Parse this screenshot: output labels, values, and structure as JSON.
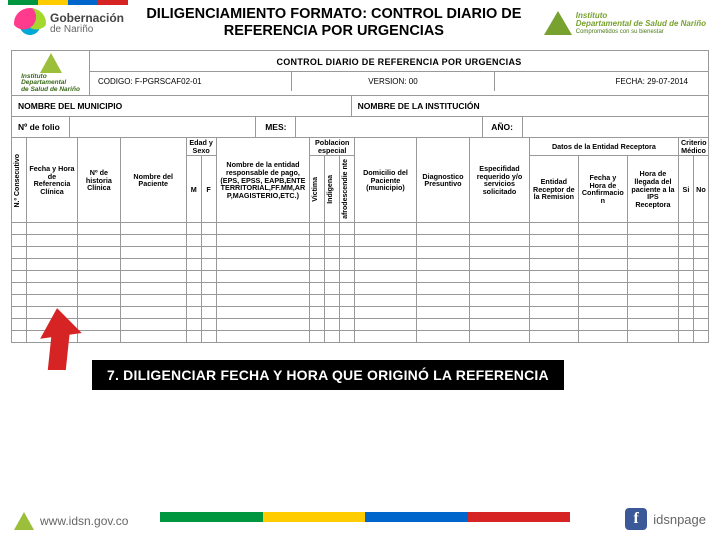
{
  "colors": {
    "green": "#009640",
    "yellow": "#ffcc00",
    "blue": "#0066cc",
    "red": "#d62424"
  },
  "header": {
    "gob_label": "Gobernación",
    "gob_sub": "de Nariño",
    "title": "DILIGENCIAMIENTO FORMATO: CONTROL DIARIO DE REFERENCIA POR URGENCIAS",
    "idsn_line1": "Instituto",
    "idsn_line2": "Departamental de Salud de Nariño",
    "idsn_tag": "Comprometidos con su bienestar"
  },
  "sheet": {
    "logo_line1": "Instituto",
    "logo_line2": "Departamental",
    "logo_line3": "de Salud de Nariño",
    "heading": "CONTROL DIARIO DE REFERENCIA POR URGENCIAS",
    "codigo_lab": "CODIGO:",
    "codigo_val": "F-PGRSCAF02-01",
    "version_lab": "VERSION:",
    "version_val": "00",
    "fecha_lab": "FECHA:",
    "fecha_val": "29-07-2014",
    "municipio": "NOMBRE DEL MUNICIPIO",
    "institucion": "NOMBRE DE LA INSTITUCIÓN",
    "folio": "Nº de folio",
    "mes": "MES:",
    "ano": "AÑO:"
  },
  "cols": {
    "c0": "N.º Consecutivo",
    "c1": "Fecha y Hora de Referencia Clínica",
    "c2": "Nº de historia Clínica",
    "c3": "Nombre del Paciente",
    "c4": "Edad y Sexo",
    "c4m": "M",
    "c4f": "F",
    "c5": "Nombre de la entidad responsable de pago, (EPS, EPSS, EAPB,ENTE TERRITORIAL,FF.MM,AR P,MAGISTERIO,ETC.)",
    "c6": "Poblacion especial",
    "c6a": "Victima",
    "c6b": "Indigena",
    "c6c": "afrodescendie nte",
    "c7": "Domicilio del Paciente (municipio)",
    "c8": "Diagnostico Presuntivo",
    "c9": "Especifidad requerido y/o servicios solicitado",
    "c10": "Datos de la Entidad Receptora",
    "c10a": "Entidad Receptor de la Remision",
    "c10b": "Fecha y Hora de Confirmacio n",
    "c10c": "Hora de llegada del paciente a la IPS Receptora",
    "c11": "Criterio Médico",
    "c11a": "Si",
    "c11b": "No"
  },
  "caption": "7. DILIGENCIAR FECHA Y HORA QUE ORIGINÓ LA REFERENCIA",
  "footer": {
    "url": "www.idsn.gov.co",
    "page": "idsnpage"
  }
}
